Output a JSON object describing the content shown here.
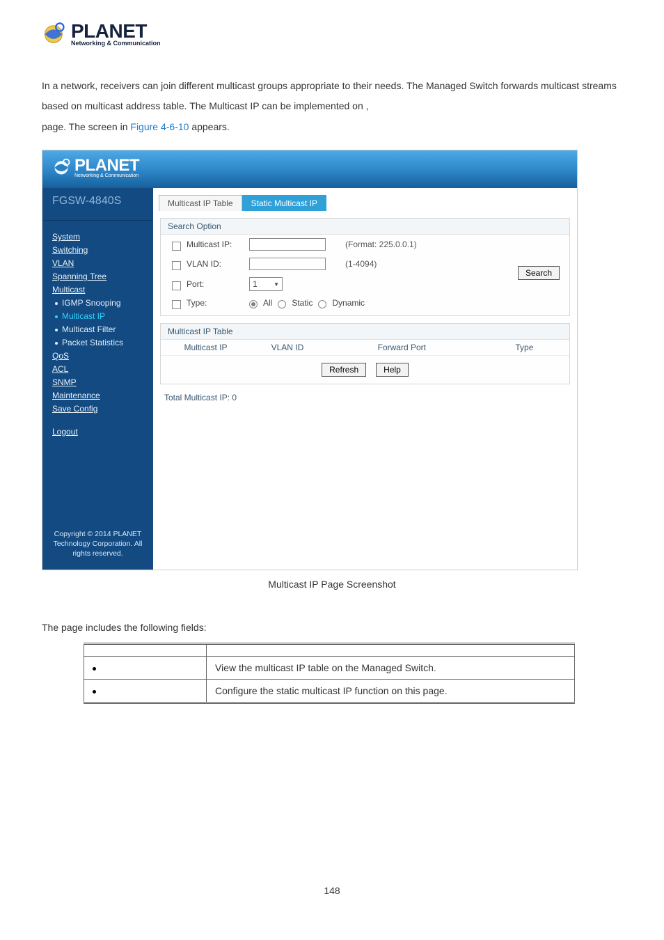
{
  "brand": {
    "name": "PLANET",
    "tagline": "Networking & Communication"
  },
  "intro": {
    "part1": "In a network, receivers can join different multicast groups appropriate to their needs. The Managed Switch forwards multicast streams based on multicast address table. The Multicast IP can be implemented on",
    "comma": ",",
    "part2_prefix": "page. The screen in ",
    "figure_ref": "Figure 4-6-10",
    "part2_suffix": " appears."
  },
  "switchui": {
    "brand": {
      "name": "PLANET",
      "tagline": "Networking & Communication"
    },
    "model": "FGSW-4840S",
    "nav": {
      "items": [
        "System",
        "Switching",
        "VLAN",
        "Spanning Tree",
        "Multicast"
      ],
      "sub_multicast": [
        "IGMP Snooping",
        "Multicast IP",
        "Multicast Filter",
        "Packet Statistics"
      ],
      "current": "Multicast IP",
      "items2": [
        "QoS",
        "ACL",
        "SNMP",
        "Maintenance",
        "Save Config"
      ],
      "logout": "Logout"
    },
    "copyright": "Copyright © 2014 PLANET Technology Corporation. All rights reserved.",
    "tabs": {
      "tab1": "Multicast IP Table",
      "tab2": "Static Multicast IP"
    },
    "search": {
      "legend": "Search Option",
      "f_multicast": "Multicast IP:",
      "hint_multicast": "(Format: 225.0.0.1)",
      "f_vlan": "VLAN ID:",
      "hint_vlan": "(1-4094)",
      "f_port": "Port:",
      "port_value": "1",
      "f_type": "Type:",
      "type_all": "All",
      "type_static": "Static",
      "type_dynamic": "Dynamic",
      "btn": "Search"
    },
    "table": {
      "legend": "Multicast IP Table",
      "h1": "Multicast IP",
      "h2": "VLAN ID",
      "h3": "Forward Port",
      "h4": "Type",
      "refresh": "Refresh",
      "help": "Help",
      "total": "Total Multicast IP: 0"
    }
  },
  "caption": "Multicast IP Page Screenshot",
  "below_intro": "The page includes the following fields:",
  "object_table": {
    "r1_desc": "View the multicast IP table on the Managed Switch.",
    "r2_desc": "Configure the static multicast IP function on this page."
  },
  "page_number": "148"
}
